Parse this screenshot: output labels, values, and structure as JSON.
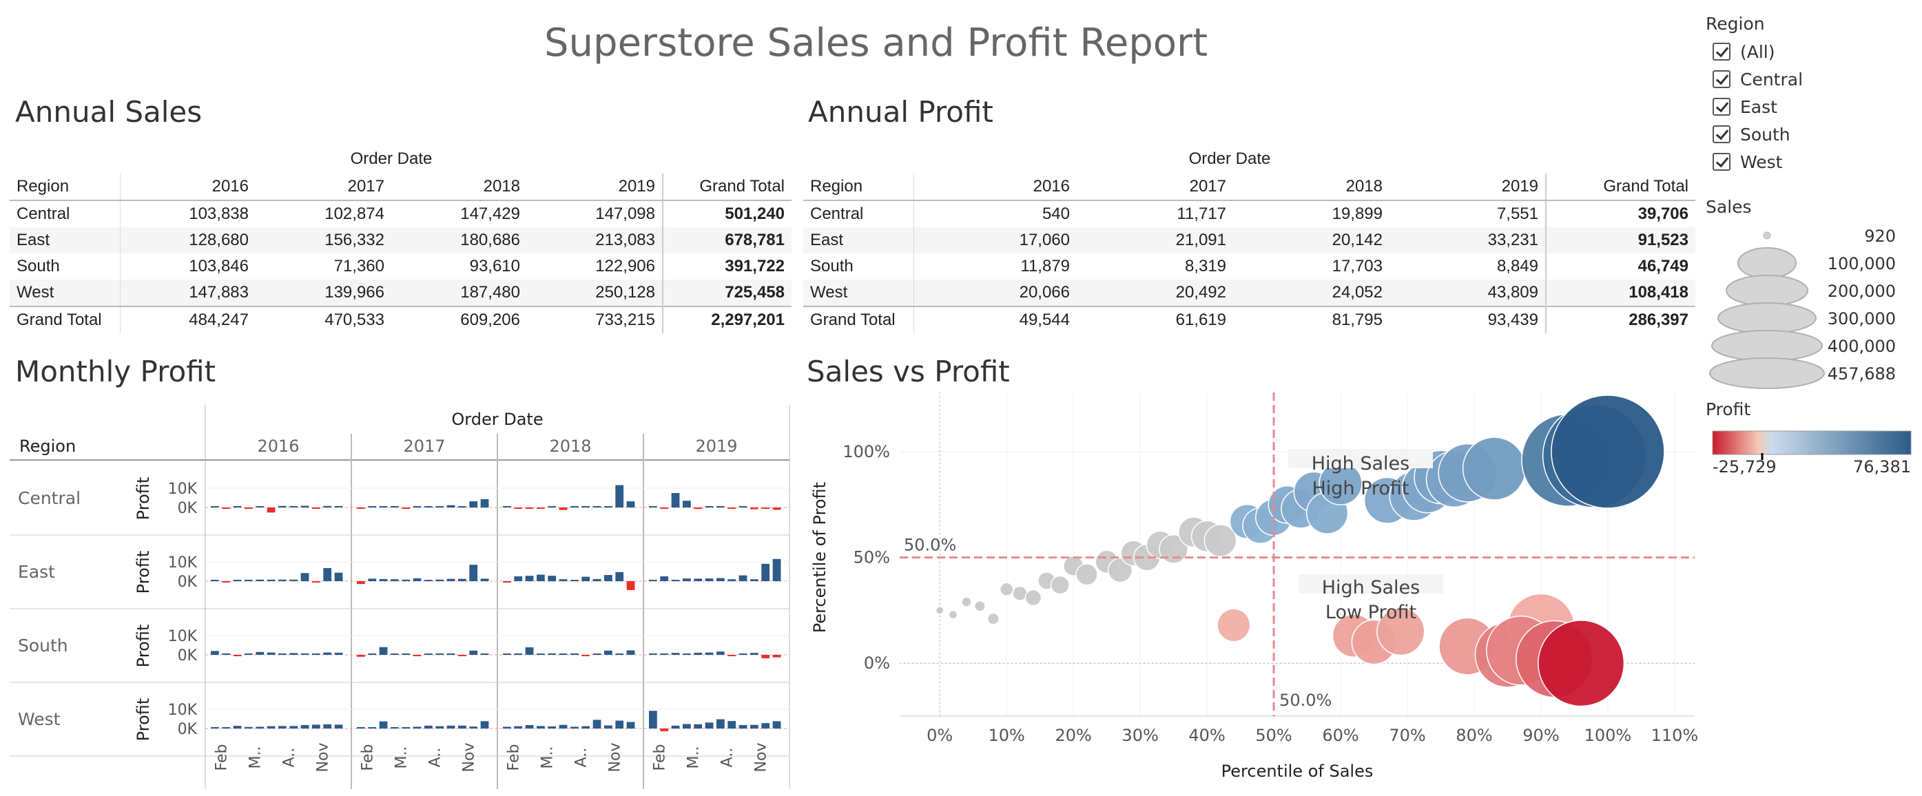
{
  "title": "Superstore Sales and Profit Report",
  "annual_sales": {
    "title": "Annual Sales",
    "order_date_label": "Order Date",
    "region_label": "Region",
    "columns": [
      "2016",
      "2017",
      "2018",
      "2019",
      "Grand Total"
    ],
    "rows": [
      {
        "region": "Central",
        "values": [
          "103,838",
          "102,874",
          "147,429",
          "147,098",
          "501,240"
        ]
      },
      {
        "region": "East",
        "values": [
          "128,680",
          "156,332",
          "180,686",
          "213,083",
          "678,781"
        ]
      },
      {
        "region": "South",
        "values": [
          "103,846",
          "71,360",
          "93,610",
          "122,906",
          "391,722"
        ]
      },
      {
        "region": "West",
        "values": [
          "147,883",
          "139,966",
          "187,480",
          "250,128",
          "725,458"
        ]
      },
      {
        "region": "Grand Total",
        "values": [
          "484,247",
          "470,533",
          "609,206",
          "733,215",
          "2,297,201"
        ]
      }
    ]
  },
  "annual_profit": {
    "title": "Annual Profit",
    "order_date_label": "Order Date",
    "region_label": "Region",
    "columns": [
      "2016",
      "2017",
      "2018",
      "2019",
      "Grand Total"
    ],
    "rows": [
      {
        "region": "Central",
        "values": [
          "540",
          "11,717",
          "19,899",
          "7,551",
          "39,706"
        ]
      },
      {
        "region": "East",
        "values": [
          "17,060",
          "21,091",
          "20,142",
          "33,231",
          "91,523"
        ]
      },
      {
        "region": "South",
        "values": [
          "11,879",
          "8,319",
          "17,703",
          "8,849",
          "46,749"
        ]
      },
      {
        "region": "West",
        "values": [
          "20,066",
          "20,492",
          "24,052",
          "43,809",
          "108,418"
        ]
      },
      {
        "region": "Grand Total",
        "values": [
          "49,544",
          "61,619",
          "81,795",
          "93,439",
          "286,397"
        ]
      }
    ]
  },
  "monthly_profit": {
    "title": "Monthly Profit",
    "order_date_label": "Order Date",
    "region_label": "Region",
    "measure_label": "Profit",
    "years": [
      "2016",
      "2017",
      "2018",
      "2019"
    ],
    "regions": [
      "Central",
      "East",
      "South",
      "West"
    ],
    "y_ticks": [
      "10K",
      "0K"
    ],
    "month_ticks": [
      "Feb",
      "M..",
      "A..",
      "Nov"
    ]
  },
  "sales_vs_profit": {
    "title": "Sales vs Profit",
    "xlabel": "Percentile of Sales",
    "ylabel": "Percentile of Profit",
    "x_ticks": [
      "0%",
      "10%",
      "20%",
      "30%",
      "40%",
      "50%",
      "60%",
      "70%",
      "80%",
      "90%",
      "100%",
      "110%"
    ],
    "y_ticks": [
      "100%",
      "50%",
      "0%"
    ],
    "ref_x_label": "50.0%",
    "ref_y_label": "50.0%",
    "annotation_high_high": [
      "High Sales",
      "High Profit"
    ],
    "annotation_high_low": [
      "High Sales",
      "Low Profit"
    ]
  },
  "filters": {
    "region_title": "Region",
    "region_options": [
      "(All)",
      "Central",
      "East",
      "South",
      "West"
    ],
    "sales_title": "Sales",
    "sales_sizes": [
      "920",
      "100,000",
      "200,000",
      "300,000",
      "400,000",
      "457,688"
    ],
    "profit_title": "Profit",
    "profit_min": "-25,729",
    "profit_max": "76,381"
  },
  "colors": {
    "pos_bar": "#2d5b8a",
    "neg_bar": "#e8302a",
    "ref_line": "#e88a90",
    "legend_low": "#d01c2c",
    "legend_high": "#2b5b88"
  },
  "chart_data": [
    {
      "type": "bar",
      "title": "Monthly Profit",
      "ylabel": "Profit",
      "ylim": [
        -4000,
        12000
      ],
      "years": [
        "2016",
        "2017",
        "2018",
        "2019"
      ],
      "months_per_year": 12,
      "series": [
        {
          "name": "Central",
          "values": [
            200,
            -100,
            300,
            -200,
            600,
            -2600,
            800,
            500,
            900,
            -600,
            800,
            200,
            -300,
            300,
            200,
            300,
            -200,
            600,
            300,
            400,
            1200,
            600,
            3200,
            4300,
            200,
            -200,
            -100,
            -300,
            500,
            -1300,
            600,
            500,
            600,
            300,
            11600,
            3200,
            600,
            -400,
            7500,
            3500,
            -800,
            300,
            500,
            -700,
            200,
            -900,
            -700,
            -1200
          ]
        },
        {
          "name": "East",
          "values": [
            200,
            -100,
            300,
            200,
            800,
            800,
            800,
            800,
            4200,
            -200,
            6800,
            4400,
            -1500,
            1300,
            1100,
            1000,
            800,
            1500,
            700,
            800,
            1200,
            1200,
            8500,
            1300,
            -200,
            2500,
            2800,
            3400,
            2800,
            1000,
            500,
            2300,
            1100,
            3200,
            4700,
            -4600,
            600,
            2500,
            600,
            1400,
            1300,
            1400,
            1600,
            1000,
            3000,
            1000,
            9000,
            11500
          ]
        },
        {
          "name": "South",
          "values": [
            2000,
            200,
            -200,
            500,
            1500,
            1200,
            600,
            900,
            700,
            200,
            1200,
            1100,
            -1000,
            500,
            4000,
            500,
            300,
            -200,
            500,
            400,
            600,
            -300,
            2200,
            500,
            200,
            500,
            3900,
            500,
            200,
            600,
            100,
            -200,
            600,
            2200,
            700,
            2300,
            600,
            300,
            1000,
            400,
            1100,
            1200,
            1700,
            -300,
            500,
            1000,
            -1800,
            -1300
          ]
        },
        {
          "name": "West",
          "values": [
            100,
            700,
            1400,
            800,
            900,
            1200,
            1300,
            1300,
            1800,
            2000,
            2200,
            2000,
            200,
            600,
            3700,
            600,
            700,
            900,
            1500,
            1200,
            1500,
            1500,
            1000,
            3800,
            900,
            1200,
            1800,
            1300,
            1100,
            1900,
            900,
            1200,
            4500,
            1600,
            4100,
            3400,
            9200,
            -1400,
            1500,
            2300,
            2200,
            3100,
            4800,
            3900,
            1800,
            1900,
            2800,
            3800
          ]
        }
      ]
    },
    {
      "type": "scatter",
      "title": "Sales vs Profit",
      "xlabel": "Percentile of Sales",
      "ylabel": "Percentile of Profit",
      "xlim": [
        -0.06,
        1.13
      ],
      "ylim": [
        -0.25,
        1.28
      ],
      "reference_lines": {
        "x": 0.5,
        "y": 0.5
      },
      "points": [
        {
          "x": 0.0,
          "y": 0.25,
          "sales": 920,
          "profit": 10
        },
        {
          "x": 0.02,
          "y": 0.23,
          "sales": 1200,
          "profit": 20
        },
        {
          "x": 0.04,
          "y": 0.29,
          "sales": 1800,
          "profit": 60
        },
        {
          "x": 0.06,
          "y": 0.27,
          "sales": 2300,
          "profit": 50
        },
        {
          "x": 0.08,
          "y": 0.21,
          "sales": 2800,
          "profit": 15
        },
        {
          "x": 0.1,
          "y": 0.35,
          "sales": 4000,
          "profit": 150
        },
        {
          "x": 0.12,
          "y": 0.33,
          "sales": 5000,
          "profit": 130
        },
        {
          "x": 0.14,
          "y": 0.31,
          "sales": 6500,
          "profit": 100
        },
        {
          "x": 0.16,
          "y": 0.39,
          "sales": 8000,
          "profit": 260
        },
        {
          "x": 0.18,
          "y": 0.37,
          "sales": 9000,
          "profit": 230
        },
        {
          "x": 0.2,
          "y": 0.46,
          "sales": 11000,
          "profit": 500
        },
        {
          "x": 0.22,
          "y": 0.42,
          "sales": 13000,
          "profit": 380
        },
        {
          "x": 0.25,
          "y": 0.48,
          "sales": 15000,
          "profit": 560
        },
        {
          "x": 0.27,
          "y": 0.44,
          "sales": 17000,
          "profit": 420
        },
        {
          "x": 0.29,
          "y": 0.52,
          "sales": 19000,
          "profit": 680
        },
        {
          "x": 0.31,
          "y": 0.5,
          "sales": 21000,
          "profit": 620
        },
        {
          "x": 0.33,
          "y": 0.56,
          "sales": 23000,
          "profit": 800
        },
        {
          "x": 0.35,
          "y": 0.54,
          "sales": 25000,
          "profit": 750
        },
        {
          "x": 0.38,
          "y": 0.62,
          "sales": 28000,
          "profit": 1200
        },
        {
          "x": 0.4,
          "y": 0.6,
          "sales": 30000,
          "profit": 1100
        },
        {
          "x": 0.42,
          "y": 0.58,
          "sales": 32000,
          "profit": 1000
        },
        {
          "x": 0.44,
          "y": 0.18,
          "sales": 34000,
          "profit": -800
        },
        {
          "x": 0.46,
          "y": 0.67,
          "sales": 37000,
          "profit": 2500
        },
        {
          "x": 0.48,
          "y": 0.65,
          "sales": 40000,
          "profit": 2300
        },
        {
          "x": 0.5,
          "y": 0.69,
          "sales": 42000,
          "profit": 2800
        },
        {
          "x": 0.52,
          "y": 0.75,
          "sales": 45000,
          "profit": 4200
        },
        {
          "x": 0.54,
          "y": 0.73,
          "sales": 48000,
          "profit": 4000
        },
        {
          "x": 0.56,
          "y": 0.81,
          "sales": 52000,
          "profit": 5600
        },
        {
          "x": 0.58,
          "y": 0.71,
          "sales": 56000,
          "profit": 3500
        },
        {
          "x": 0.6,
          "y": 0.85,
          "sales": 60000,
          "profit": 6800
        },
        {
          "x": 0.62,
          "y": 0.13,
          "sales": 60000,
          "profit": -3000
        },
        {
          "x": 0.65,
          "y": 0.1,
          "sales": 65000,
          "profit": -3500
        },
        {
          "x": 0.67,
          "y": 0.77,
          "sales": 70000,
          "profit": 5000
        },
        {
          "x": 0.69,
          "y": 0.15,
          "sales": 75000,
          "profit": -2800
        },
        {
          "x": 0.71,
          "y": 0.79,
          "sales": 80000,
          "profit": 5300
        },
        {
          "x": 0.73,
          "y": 0.83,
          "sales": 85000,
          "profit": 6200
        },
        {
          "x": 0.75,
          "y": 0.88,
          "sales": 95000,
          "profit": 8000
        },
        {
          "x": 0.79,
          "y": 0.08,
          "sales": 110000,
          "profit": -4500
        },
        {
          "x": 0.77,
          "y": 0.87,
          "sales": 105000,
          "profit": 7500
        },
        {
          "x": 0.79,
          "y": 0.9,
          "sales": 115000,
          "profit": 9000
        },
        {
          "x": 0.83,
          "y": 0.92,
          "sales": 135000,
          "profit": 11000
        },
        {
          "x": 0.85,
          "y": 0.04,
          "sales": 145000,
          "profit": -9000
        },
        {
          "x": 0.87,
          "y": 0.06,
          "sales": 165000,
          "profit": -8000
        },
        {
          "x": 0.9,
          "y": 0.17,
          "sales": 155000,
          "profit": -1500
        },
        {
          "x": 0.92,
          "y": 0.02,
          "sales": 205000,
          "profit": -13000
        },
        {
          "x": 0.96,
          "y": 0.0,
          "sales": 260000,
          "profit": -25729
        },
        {
          "x": 0.94,
          "y": 0.96,
          "sales": 300000,
          "profit": 35000
        },
        {
          "x": 0.98,
          "y": 0.98,
          "sales": 380000,
          "profit": 55000
        },
        {
          "x": 1.0,
          "y": 1.0,
          "sales": 457688,
          "profit": 76381
        }
      ]
    }
  ]
}
